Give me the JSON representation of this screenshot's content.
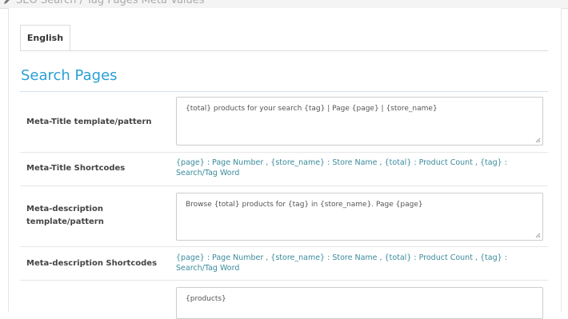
{
  "header": {
    "title": "SEO Search / Tag Pages Meta Values"
  },
  "tabs": [
    {
      "label": "English"
    }
  ],
  "section": {
    "title": "Search Pages"
  },
  "rows": [
    {
      "label": "Meta-Title template/pattern",
      "value": "{total} products for your search {tag} | Page {page} | {store_name}"
    },
    {
      "label": "Meta-Title Shortcodes",
      "shortcodes": "{page} : Page Number , {store_name} : Store Name , {total} : Product Count , {tag} : Search/Tag Word"
    },
    {
      "label": "Meta-description template/pattern",
      "value": "Browse {total} products for {tag} in {store_name}. Page {page}"
    },
    {
      "label": "Meta-description Shortcodes",
      "shortcodes": "{page} : Page Number , {store_name} : Store Name , {total} : Product Count , {tag} : Search/Tag Word"
    },
    {
      "value": "{products}"
    }
  ]
}
